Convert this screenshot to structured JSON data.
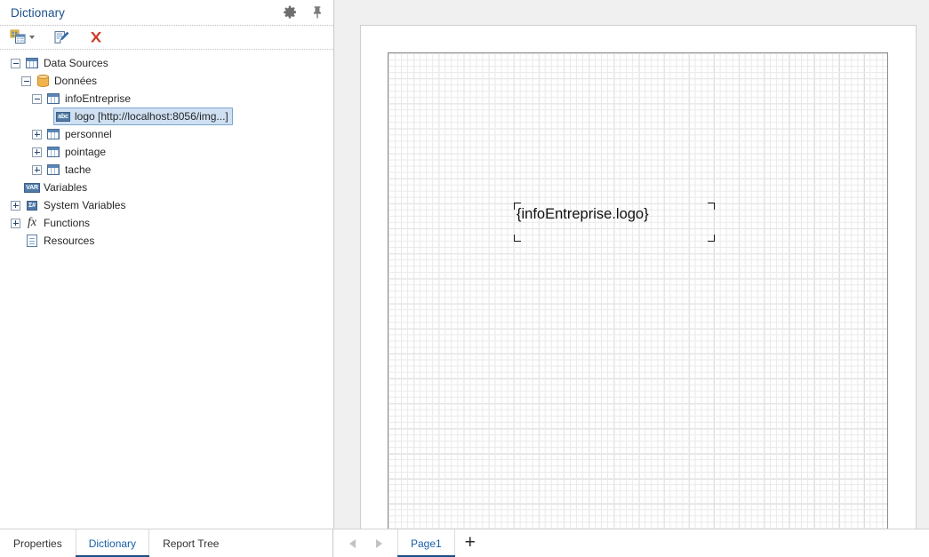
{
  "panel": {
    "title": "Dictionary",
    "header_icons": [
      {
        "name": "gear-icon",
        "label": "Settings"
      },
      {
        "name": "pin-icon",
        "label": "Pin panel"
      }
    ],
    "toolbar": [
      {
        "name": "new-item-button",
        "label": "New Item",
        "icon": "new-data-source-icon",
        "has_caret": true
      },
      {
        "name": "edit-item-button",
        "label": "Edit",
        "icon": "edit-pencil-icon",
        "has_caret": false
      },
      {
        "name": "delete-item-button",
        "label": "Delete",
        "icon": "red-x-icon",
        "has_caret": false
      }
    ]
  },
  "tree": [
    {
      "label": "Data Sources",
      "indent": 0,
      "toggle": "minus",
      "icon": "table-icon",
      "selected": false
    },
    {
      "label": "Données",
      "indent": 1,
      "toggle": "minus",
      "icon": "database-icon",
      "selected": false
    },
    {
      "label": "infoEntreprise",
      "indent": 2,
      "toggle": "minus",
      "icon": "table-icon",
      "selected": false
    },
    {
      "label": "logo [http://localhost:8056/img...]",
      "indent": 3,
      "toggle": "none",
      "icon": "abc-string-icon",
      "selected": true
    },
    {
      "label": "personnel",
      "indent": 2,
      "toggle": "plus",
      "icon": "table-icon",
      "selected": false
    },
    {
      "label": "pointage",
      "indent": 2,
      "toggle": "plus",
      "icon": "table-icon",
      "selected": false
    },
    {
      "label": "tache",
      "indent": 2,
      "toggle": "plus",
      "icon": "table-icon",
      "selected": false
    },
    {
      "label": "Variables",
      "indent": 1,
      "toggle": "none",
      "icon": "var-icon",
      "selected": false
    },
    {
      "label": "System Variables",
      "indent": 0,
      "toggle": "plus",
      "icon": "sigma-hash-icon",
      "selected": false
    },
    {
      "label": "Functions",
      "indent": 0,
      "toggle": "plus",
      "icon": "fx-icon",
      "selected": false
    },
    {
      "label": "Resources",
      "indent": 1,
      "toggle": "none",
      "icon": "resources-icon",
      "selected": false
    }
  ],
  "tree_icon_badges": {
    "abc-string-icon": "abc",
    "var-icon": "VAR",
    "sigma-hash-icon": "Σ#",
    "fx-icon": "fx"
  },
  "canvas": {
    "text_component": {
      "text": "{infoEntreprise.logo}",
      "selected": true
    }
  },
  "bottom_tabs": [
    {
      "label": "Properties",
      "name": "tab-properties",
      "active": false
    },
    {
      "label": "Dictionary",
      "name": "tab-dictionary",
      "active": true
    },
    {
      "label": "Report Tree",
      "name": "tab-report-tree",
      "active": false
    }
  ],
  "page_tabs": {
    "prev_label": "◀",
    "next_label": "▶",
    "tabs": [
      {
        "label": "Page1",
        "active": true
      }
    ],
    "add_label": "+"
  },
  "colors": {
    "accent_blue": "#1a5fa8",
    "title_blue": "#1a4f8a",
    "tab_underline": "#1b4f86",
    "selection_fill": "#cfe0f2",
    "selection_border": "#7da6d0",
    "panel_bg": "#ffffff",
    "canvas_bg": "#f0f0f0",
    "grid_line": "#e9e9e9",
    "grid_major": "#d2d2d2",
    "db_icon": "#f0b34d",
    "delete_red": "#cc3b2b"
  }
}
